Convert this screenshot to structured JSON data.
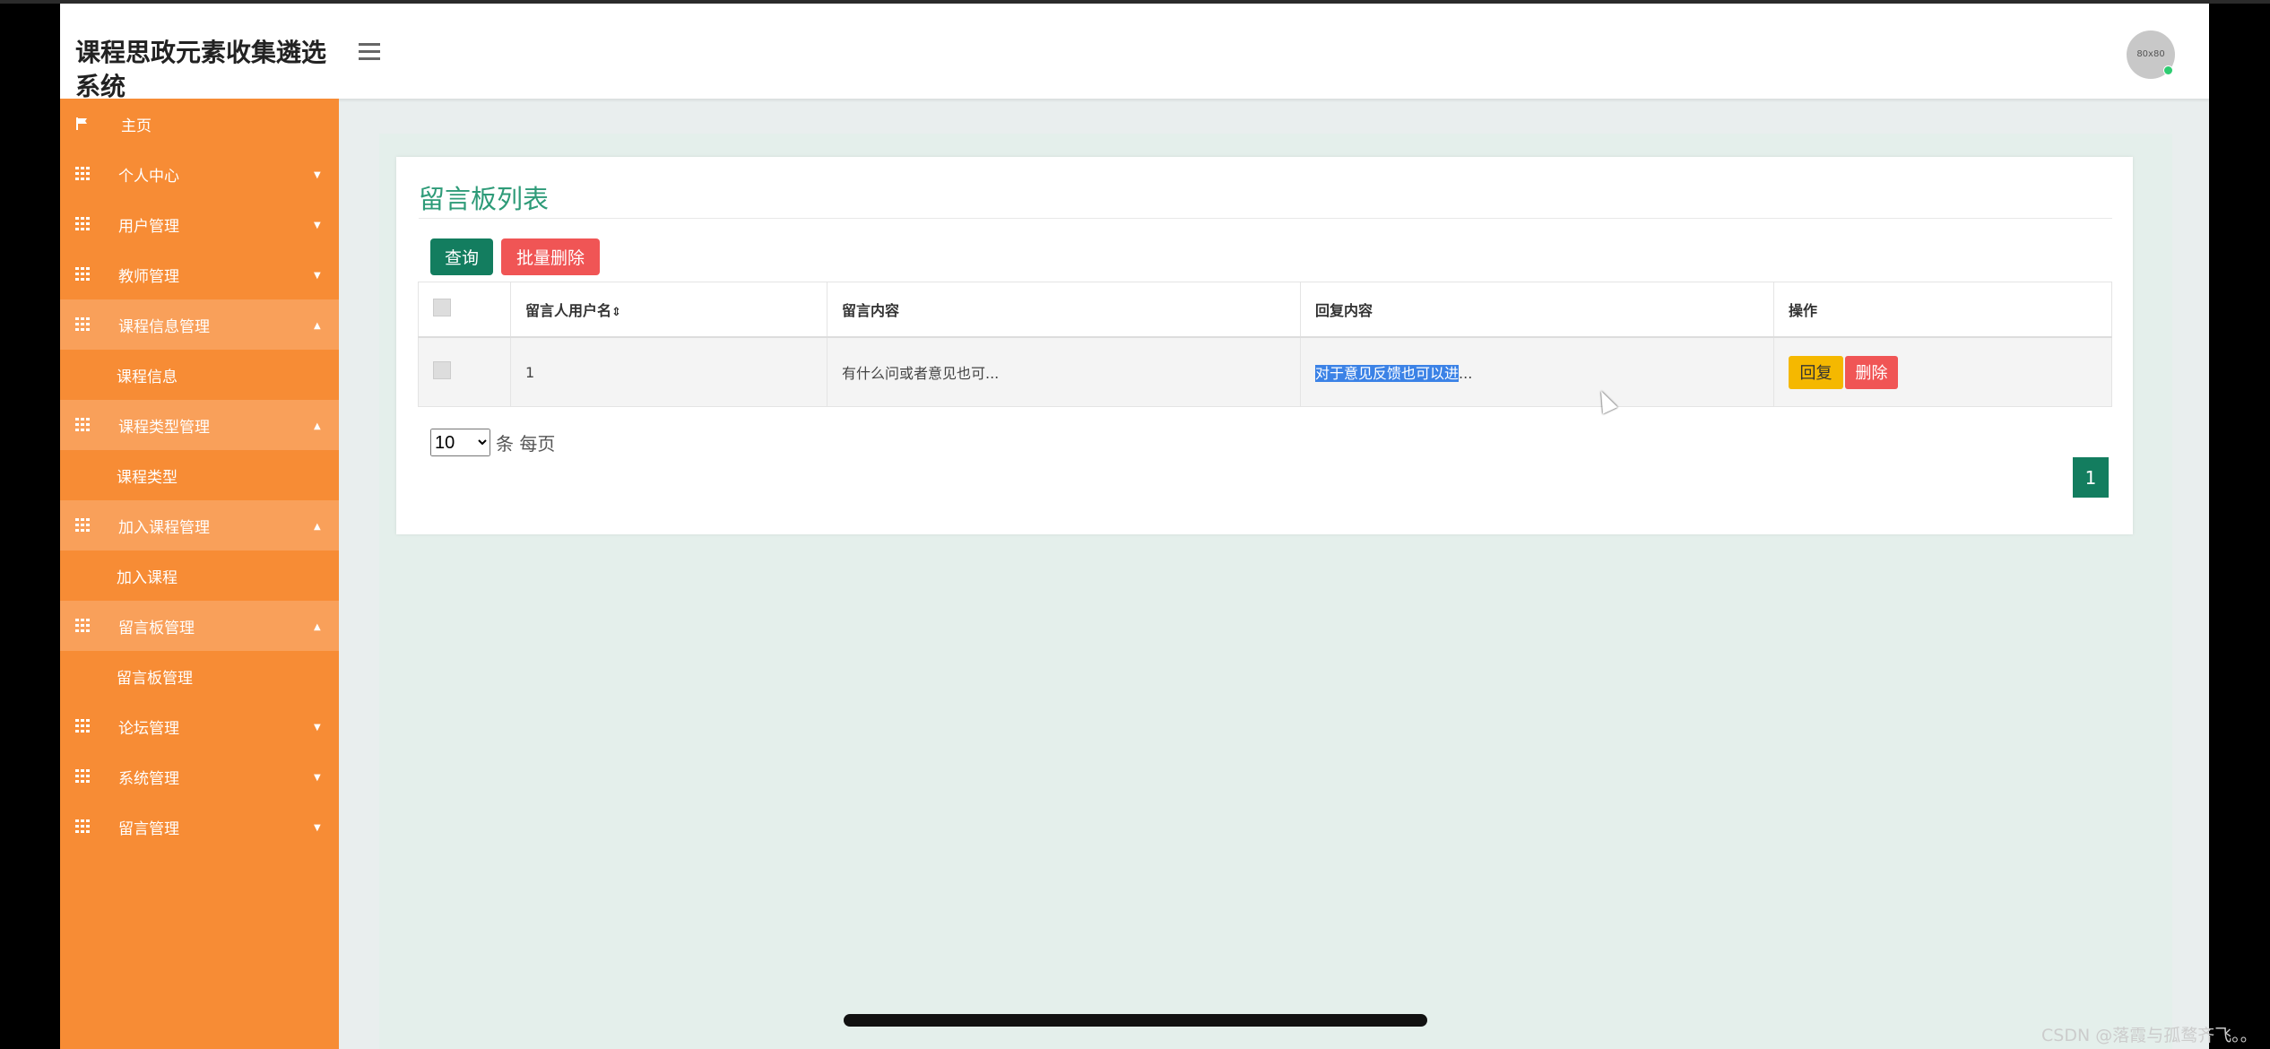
{
  "header": {
    "app_title": "课程思政元素收集遴选系统",
    "avatar_text": "80x80"
  },
  "sidebar": {
    "items": [
      {
        "label": "主页",
        "icon": "flag-icon",
        "expanded": false,
        "has_caret": false
      },
      {
        "label": "个人中心",
        "icon": "grid-icon",
        "expanded": false
      },
      {
        "label": "用户管理",
        "icon": "grid-icon",
        "expanded": false
      },
      {
        "label": "教师管理",
        "icon": "grid-icon",
        "expanded": false
      },
      {
        "label": "课程信息管理",
        "icon": "grid-icon",
        "expanded": true,
        "sub": "课程信息"
      },
      {
        "label": "课程类型管理",
        "icon": "grid-icon",
        "expanded": true,
        "sub": "课程类型"
      },
      {
        "label": "加入课程管理",
        "icon": "grid-icon",
        "expanded": true,
        "sub": "加入课程"
      },
      {
        "label": "留言板管理",
        "icon": "grid-icon",
        "expanded": true,
        "sub": "留言板管理"
      },
      {
        "label": "论坛管理",
        "icon": "grid-icon",
        "expanded": false
      },
      {
        "label": "系统管理",
        "icon": "grid-icon",
        "expanded": false
      },
      {
        "label": "留言管理",
        "icon": "grid-icon",
        "expanded": false
      }
    ]
  },
  "panel": {
    "title": "留言板列表",
    "query_button": "查询",
    "batch_delete_button": "批量删除"
  },
  "table": {
    "headers": [
      "留言人用户名",
      "留言内容",
      "回复内容",
      "操作"
    ],
    "sort_indicator": "⇕",
    "rows": [
      {
        "username": "1",
        "message": "有什么问或者意见也可...",
        "reply_selected": "对于意见反馈也可以进",
        "reply_rest": "...",
        "reply_button": "回复",
        "delete_button": "删除"
      }
    ]
  },
  "pagination": {
    "page_size": "10",
    "page_size_options": [
      "10"
    ],
    "per_page_text": "条 每页",
    "current_page": "1"
  },
  "watermark": "CSDN @落霞与孤鹜齐飞。。",
  "colors": {
    "sidebar": "#f78c35",
    "accent_green": "#137d5f",
    "danger": "#f05555",
    "warning": "#f5b800",
    "title_green": "#2e9b78"
  }
}
